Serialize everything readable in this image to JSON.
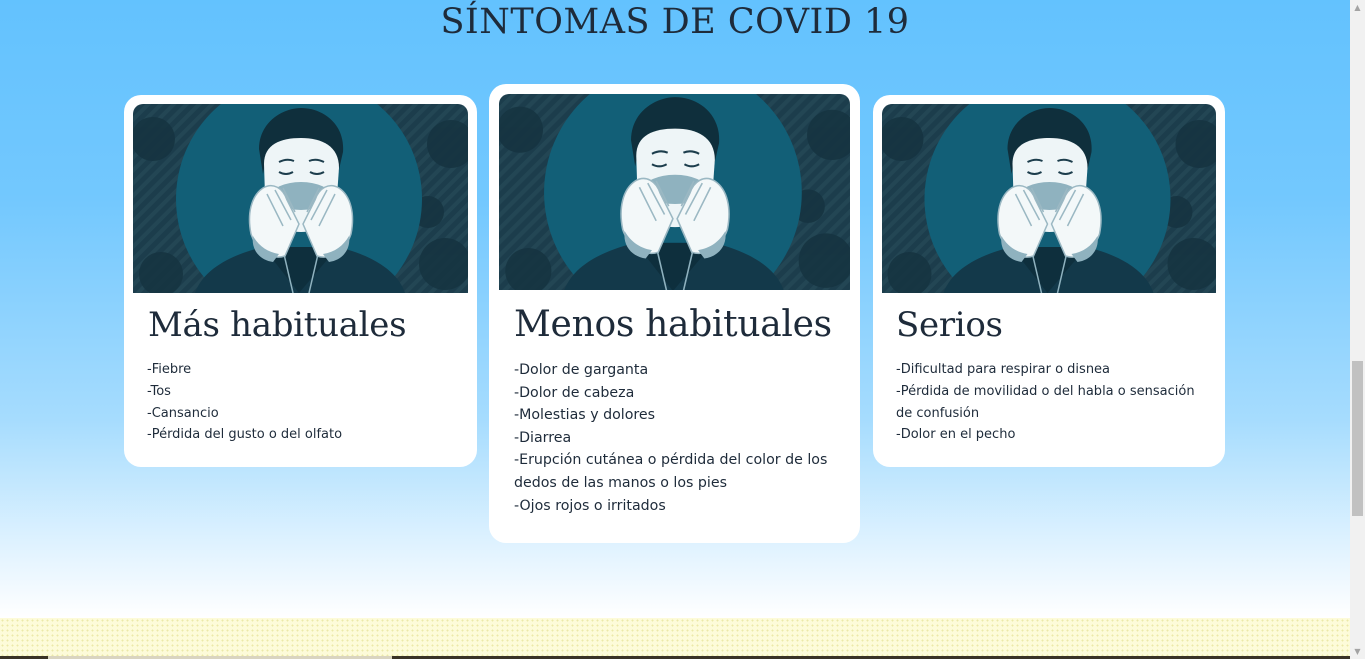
{
  "page": {
    "title": "SÍNTOMAS DE COVID 19"
  },
  "cards": [
    {
      "heading": "Más habituales",
      "items": [
        "-Fiebre",
        "-Tos",
        "-Cansancio",
        "-Pérdida del gusto o del olfato"
      ]
    },
    {
      "heading": "Menos habituales",
      "items": [
        "-Dolor de garganta",
        "-Dolor de cabeza",
        "-Molestias y dolores",
        "-Diarrea",
        "-Erupción cutánea o pérdida del color de los dedos de las manos o los pies",
        "-Ojos rojos o irritados"
      ]
    },
    {
      "heading": "Serios",
      "items": [
        "-Dificultad para respirar o disnea",
        "-Pérdida de movilidad o del habla o sensación de confusión",
        "-Dolor en el pecho"
      ]
    }
  ],
  "colors": {
    "background_top": "#63c2fe",
    "card": "#ffffff",
    "illustration_bg": "#1c3d4c",
    "illustration_circle": "#125f77",
    "text": "#1e2b3a"
  },
  "icons": {
    "illustration": "person-coughing-illustration",
    "scroll_up": "triangle-up-icon",
    "scroll_down": "triangle-down-icon"
  }
}
